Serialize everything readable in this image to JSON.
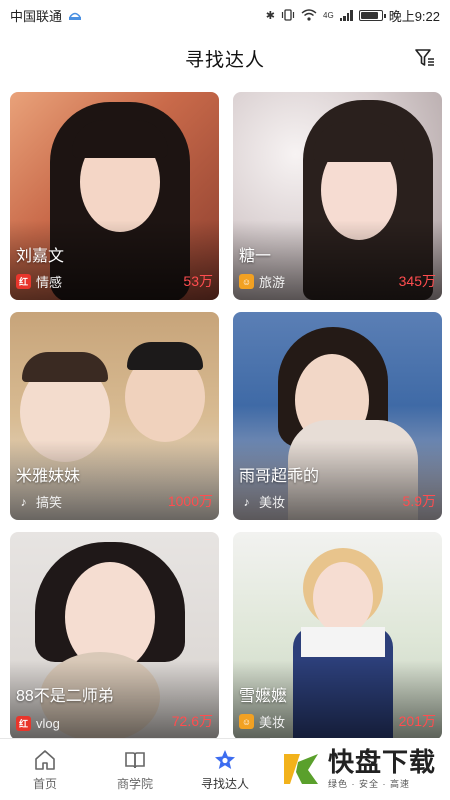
{
  "status_bar": {
    "carrier": "中国联通",
    "signal_label": "4G",
    "time": "晚上9:22",
    "battery_level": 0.85
  },
  "header": {
    "title": "寻找达人"
  },
  "cards": [
    {
      "name": "刘嘉文",
      "category": "情感",
      "count": "53万",
      "platform": "red-platform-icon"
    },
    {
      "name": "糖一",
      "category": "旅游",
      "count": "345万",
      "platform": "orange-platform-icon"
    },
    {
      "name": "米雅妹妹",
      "category": "搞笑",
      "count": "1000万",
      "platform": "tiktok-icon"
    },
    {
      "name": "雨哥超乖的",
      "category": "美妆",
      "count": "5.9万",
      "platform": "tiktok-icon"
    },
    {
      "name": "88不是二师弟",
      "category": "vlog",
      "count": "72.6万",
      "platform": "red-platform-icon"
    },
    {
      "name": "雪嬷嬷",
      "category": "美妆",
      "count": "201万",
      "platform": "orange-platform-icon"
    }
  ],
  "nav": {
    "items": [
      {
        "label": "首页",
        "icon": "home-icon"
      },
      {
        "label": "商学院",
        "icon": "book-icon"
      },
      {
        "label": "寻找达人",
        "icon": "star-icon"
      }
    ]
  },
  "watermark": {
    "main": "快盘下载",
    "sub": "绿色 · 安全 · 高速"
  },
  "colors": {
    "count_red": "#ff4d4f",
    "nav_active": "#3d6df0"
  }
}
